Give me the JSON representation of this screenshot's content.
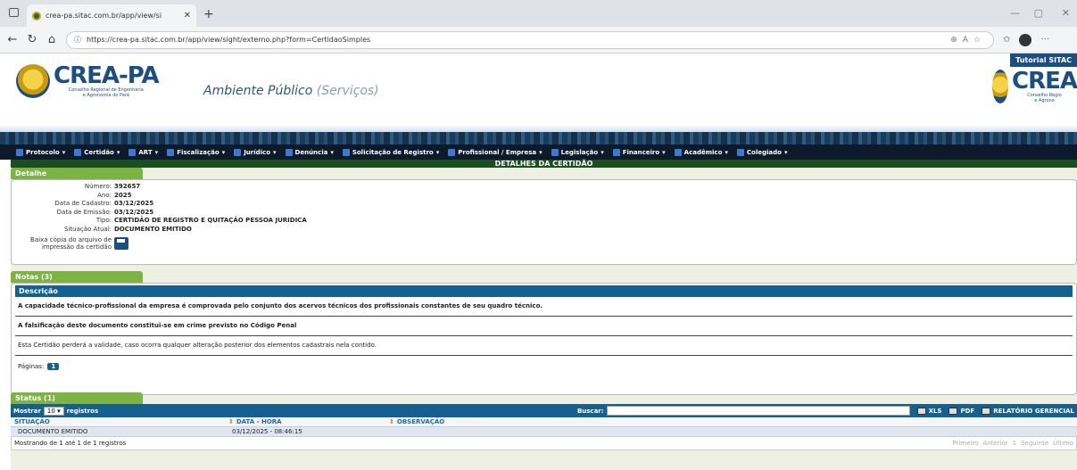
{
  "browser": {
    "tab_title": "crea-pa.sitac.com.br/app/view/si",
    "url": "https://crea-pa.sitac.com.br/app/view/sight/externo.php?form=CertidaoSimples"
  },
  "header": {
    "brand": "CREA-PA",
    "brand_sub1": "Conselho Regional de Engenharia",
    "brand_sub2": "e Agronomia do Pará",
    "ambiente": "Ambiente Público",
    "ambiente_sub": "(Serviços)",
    "tutorial": "Tutorial SITAC",
    "brand_right": "CREA",
    "brand_right_sub1": "Conselho Regio",
    "brand_right_sub2": "e Agrono"
  },
  "menu": [
    "Protocolo",
    "Certidão",
    "ART",
    "Fiscalização",
    "Jurídico",
    "Denúncia",
    "Solicitação de Registro",
    "Profissional / Empresa",
    "Legislação",
    "Financeiro",
    "Acadêmico",
    "Colegiado"
  ],
  "page_title": "DETALHES DA CERTIDÃO",
  "detalhe": {
    "title": "Detalhe",
    "fields": [
      {
        "label": "Número:",
        "value": "392657"
      },
      {
        "label": "Ano:",
        "value": "2025"
      },
      {
        "label": "Data de Cadastro:",
        "value": "03/12/2025"
      },
      {
        "label": "Data de Emissão:",
        "value": "03/12/2025"
      },
      {
        "label": "Tipo:",
        "value": "CERTIDÃO DE REGISTRO E QUITAÇÃO PESSOA JURIDICA"
      },
      {
        "label": "Situação Atual:",
        "value": "DOCUMENTO EMITIDO"
      }
    ],
    "download_label1": "Baixa cópia do arquivo de",
    "download_label2": "impressão da certidão"
  },
  "notas": {
    "title": "Notas (3)",
    "header": "Descrição",
    "rows": [
      "A capacidade técnico-profissional da empresa é comprovada pelo conjunto dos acervos técnicos dos profissionais constantes de seu quadro técnico.",
      "A falsificação deste documento constitui-se em crime previsto no Código Penal",
      "Esta Certidão perderá a validade, caso ocorra qualquer alteração posterior dos elementos cadastrais nela contido."
    ],
    "pages_label": "Páginas:",
    "page": "1"
  },
  "status": {
    "title": "Status (1)",
    "show_label": "Mostrar",
    "show_value": "10",
    "records_label": "registros",
    "search_label": "Buscar:",
    "xls": "XLS",
    "pdf": "PDF",
    "report": "RELATÓRIO GERENCIAL",
    "columns": [
      "SITUAÇÃO",
      "DATA - HORA",
      "OBSERVAÇÃO"
    ],
    "rows": [
      [
        "DOCUMENTO EMITIDO",
        "03/12/2025 - 08:46:15",
        ""
      ]
    ],
    "showing": "Mostrando de 1 até 1 de 1 registros",
    "pager": [
      "Primeiro",
      "Anterior",
      "1",
      "Seguinte",
      "Último"
    ]
  }
}
